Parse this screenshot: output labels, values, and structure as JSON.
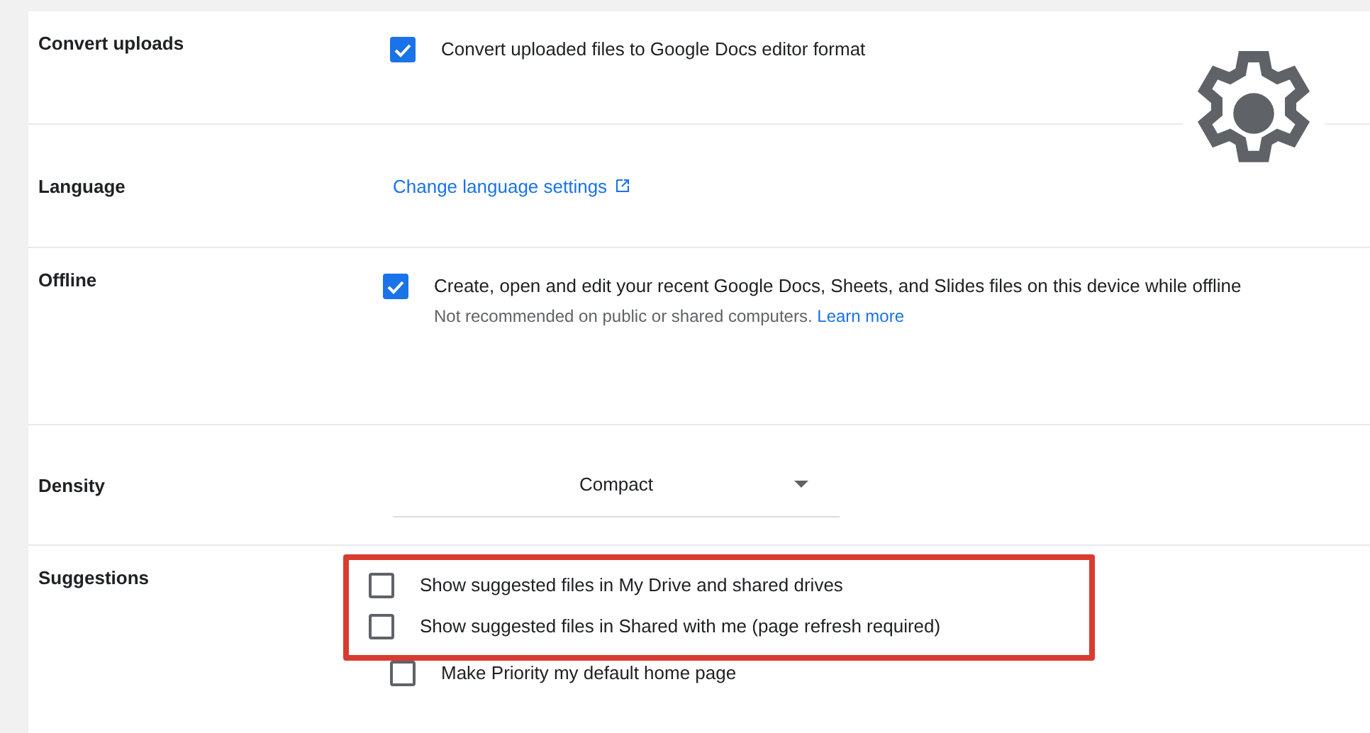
{
  "settings": [
    {
      "kind": "checkbox",
      "label": "Convert uploads",
      "options": [
        {
          "text": "Convert uploaded files to Google Docs editor format",
          "checked": true
        }
      ]
    },
    {
      "kind": "link",
      "label": "Language",
      "link": "Change language settings"
    },
    {
      "kind": "offline",
      "label": "Offline",
      "options": [
        {
          "text": "Create, open and edit your recent Google Docs, Sheets, and Slides files on this device while offline",
          "checked": true
        }
      ],
      "note": "Not recommended on public or shared computers.",
      "note_link": "Learn more"
    },
    {
      "kind": "dropdown",
      "label": "Density",
      "value": "Compact"
    },
    {
      "kind": "checkbox",
      "label": "Suggestions",
      "options": [
        {
          "text": "Show suggested files in My Drive and shared drives",
          "checked": false,
          "highlighted": true
        },
        {
          "text": "Show suggested files in Shared with me (page refresh required)",
          "checked": false,
          "highlighted": true
        },
        {
          "text": "Make Priority my default home page",
          "checked": false,
          "highlighted": false
        }
      ]
    }
  ]
}
